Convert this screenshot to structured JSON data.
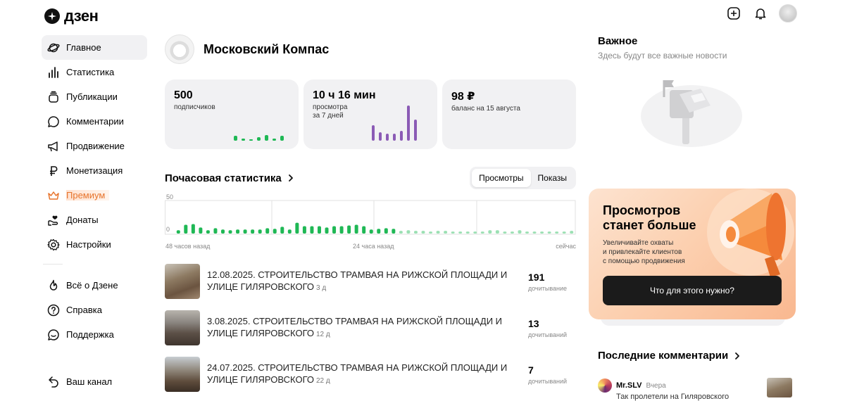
{
  "brand": {
    "name": "дзен"
  },
  "sidebar": {
    "items": [
      {
        "label": "Главное",
        "icon": "planet-icon"
      },
      {
        "label": "Статистика",
        "icon": "bar-chart-icon"
      },
      {
        "label": "Публикации",
        "icon": "stack-icon"
      },
      {
        "label": "Комментарии",
        "icon": "comment-icon"
      },
      {
        "label": "Продвижение",
        "icon": "megaphone-icon"
      },
      {
        "label": "Монетизация",
        "icon": "ruble-icon"
      },
      {
        "label": "Премиум",
        "icon": "crown-icon"
      },
      {
        "label": "Донаты",
        "icon": "donate-hand-icon"
      },
      {
        "label": "Настройки",
        "icon": "gear-icon"
      }
    ],
    "secondary": [
      {
        "label": "Всё о Дзене",
        "icon": "flame-icon"
      },
      {
        "label": "Справка",
        "icon": "help-icon"
      },
      {
        "label": "Поддержка",
        "icon": "support-icon"
      }
    ],
    "channel_link": {
      "label": "Ваш канал",
      "icon": "back-arrow-icon"
    }
  },
  "channel": {
    "name": "Московский Компас"
  },
  "stats": [
    {
      "value": "500",
      "caption": "подписчиков",
      "bars": [
        5,
        2,
        1,
        4,
        6,
        2,
        5
      ],
      "color": "#1fb855"
    },
    {
      "value": "10 ч 16 мин",
      "caption_line1": "просмотра",
      "caption_line2": "за 7 дней",
      "bars": [
        22,
        12,
        10,
        10,
        14,
        50,
        30
      ],
      "color": "#8b5bb5"
    },
    {
      "value": "98 ₽",
      "caption": "баланс на 15 августа"
    }
  ],
  "hourly": {
    "title": "Почасовая статистика",
    "tabs": [
      "Просмотры",
      "Показы"
    ],
    "active_tab": "Просмотры"
  },
  "chart_data": {
    "type": "bar",
    "ylim": [
      0,
      50
    ],
    "y_ticks": [
      "50",
      "0"
    ],
    "x_labels": [
      "48 часов назад",
      "24 часа назад",
      "сейчас"
    ],
    "values": [
      5,
      13,
      14,
      9,
      5,
      8,
      6,
      5,
      6,
      6,
      6,
      6,
      8,
      7,
      10,
      6,
      16,
      11,
      11,
      11,
      9,
      11,
      11,
      12,
      13,
      11,
      6,
      7,
      8,
      7,
      4,
      5,
      4,
      4,
      3,
      4,
      4,
      3,
      3,
      3,
      3,
      3,
      5,
      5,
      3,
      3,
      5,
      3,
      3,
      3,
      3,
      3,
      3,
      4
    ],
    "highlight_count": 30,
    "colors": {
      "recent": "#1fb855",
      "older": "#9be0b3"
    }
  },
  "publications": [
    {
      "title": "12.08.2025. СТРОИТЕЛЬСТВО ТРАМВАЯ НА РИЖСКОЙ ПЛОЩАДИ И УЛИЦЕ ГИЛЯРОВСКОГО",
      "age": "3 д",
      "count": "191",
      "metric": "дочитывание"
    },
    {
      "title": "3.08.2025. СТРОИТЕЛЬСТВО ТРАМВАЯ НА РИЖСКОЙ ПЛОЩАДИ И УЛИЦЕ ГИЛЯРОВСКОГО",
      "age": "12 д",
      "count": "13",
      "metric": "дочитываний"
    },
    {
      "title": "24.07.2025. СТРОИТЕЛЬСТВО ТРАМВАЯ НА РИЖСКОЙ ПЛОЩАДИ И УЛИЦЕ ГИЛЯРОВСКОГО",
      "age": "22 д",
      "count": "7",
      "metric": "дочитываний"
    }
  ],
  "important": {
    "title": "Важное",
    "subtitle": "Здесь будут все важные новости"
  },
  "promo": {
    "title": "Просмотров станет больше",
    "text_line1": "Увеличивайте охваты",
    "text_line2": "и привлекайте клиентов",
    "text_line3": "с помощью продвижения",
    "button": "Что для этого нужно?"
  },
  "comments": {
    "title": "Последние комментарии",
    "items": [
      {
        "author": "Mr.SLV",
        "time": "Вчера",
        "snippet": "Так пролетели на Гиляровского"
      }
    ]
  }
}
